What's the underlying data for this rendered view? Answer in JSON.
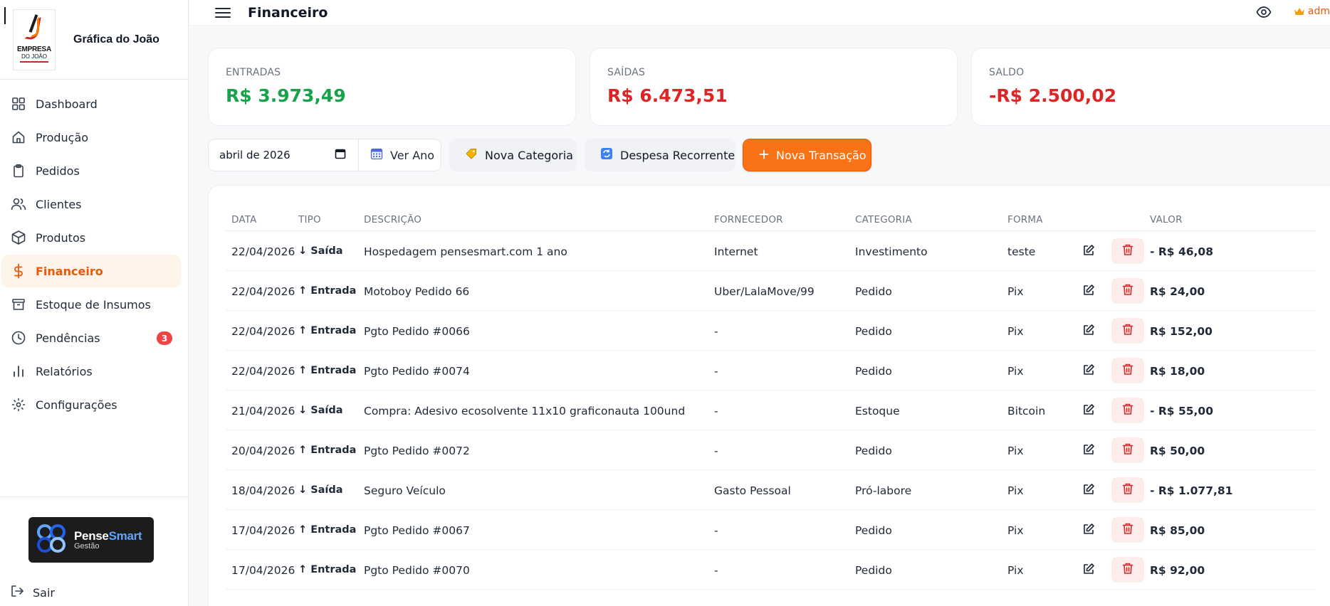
{
  "brand": {
    "logo_text_1": "EMPRESA",
    "logo_text_2": "DO JOÃO",
    "name": "Gráfica do João"
  },
  "sidebar": {
    "items": [
      {
        "label": "Dashboard",
        "icon": "grid-icon"
      },
      {
        "label": "Produção",
        "icon": "home-icon"
      },
      {
        "label": "Pedidos",
        "icon": "clipboard-icon"
      },
      {
        "label": "Clientes",
        "icon": "users-icon"
      },
      {
        "label": "Produtos",
        "icon": "box-icon"
      },
      {
        "label": "Financeiro",
        "icon": "dollar-icon",
        "active": true
      },
      {
        "label": "Estoque de Insumos",
        "icon": "archive-icon"
      },
      {
        "label": "Pendências",
        "icon": "clock-icon",
        "badge": "3"
      },
      {
        "label": "Relatórios",
        "icon": "bar-chart-icon"
      },
      {
        "label": "Configurações",
        "icon": "settings-icon"
      }
    ],
    "footer_logo_line1_a": "Pense",
    "footer_logo_line1_b": "Smart",
    "footer_logo_line2": "Gestão",
    "logout_label": "Sair"
  },
  "header": {
    "title": "Financeiro",
    "user_label": "adm"
  },
  "summary": {
    "entradas_label": "ENTRADAS",
    "entradas_value": "R$ 3.973,49",
    "saidas_label": "SAÍDAS",
    "saidas_value": "R$ 6.473,51",
    "saldo_label": "SALDO",
    "saldo_value": "-R$ 2.500,02"
  },
  "filters": {
    "month_value": "abril de 2026",
    "year_button": "Ver Ano",
    "new_category": "Nova Categoria",
    "recurring_expense": "Despesa Recorrente",
    "new_transaction": "Nova Transação"
  },
  "table": {
    "headers": [
      "DATA",
      "TIPO",
      "DESCRIÇÃO",
      "FORNECEDOR",
      "CATEGORIA",
      "FORMA",
      "VALOR"
    ],
    "rows": [
      {
        "date": "22/04/2026",
        "type": "↓ Saída",
        "kind": "out",
        "description": "Hospedagem pensesmart.com 1 ano",
        "supplier": "Internet",
        "category": "Investimento",
        "method": "teste",
        "value": "- R$ 46,08"
      },
      {
        "date": "22/04/2026",
        "type": "↑ Entrada",
        "kind": "in",
        "description": "Motoboy Pedido 66",
        "supplier": "Uber/LalaMove/99",
        "category": "Pedido",
        "method": "Pix",
        "value": "R$ 24,00"
      },
      {
        "date": "22/04/2026",
        "type": "↑ Entrada",
        "kind": "in",
        "description": "Pgto Pedido #0066",
        "supplier": "-",
        "category": "Pedido",
        "method": "Pix",
        "value": "R$ 152,00"
      },
      {
        "date": "22/04/2026",
        "type": "↑ Entrada",
        "kind": "in",
        "description": "Pgto Pedido #0074",
        "supplier": "-",
        "category": "Pedido",
        "method": "Pix",
        "value": "R$ 18,00"
      },
      {
        "date": "21/04/2026",
        "type": "↓ Saída",
        "kind": "out",
        "description": "Compra: Adesivo ecosolvente 11x10 graficonauta 100und",
        "supplier": "-",
        "category": "Estoque",
        "method": "Bitcoin",
        "value": "- R$ 55,00"
      },
      {
        "date": "20/04/2026",
        "type": "↑ Entrada",
        "kind": "in",
        "description": "Pgto Pedido #0072",
        "supplier": "-",
        "category": "Pedido",
        "method": "Pix",
        "value": "R$ 50,00"
      },
      {
        "date": "18/04/2026",
        "type": "↓ Saída",
        "kind": "out",
        "description": "Seguro Veículo",
        "supplier": "Gasto Pessoal",
        "category": "Pró-labore",
        "method": "Pix",
        "value": "- R$ 1.077,81"
      },
      {
        "date": "17/04/2026",
        "type": "↑ Entrada",
        "kind": "in",
        "description": "Pgto Pedido #0067",
        "supplier": "-",
        "category": "Pedido",
        "method": "Pix",
        "value": "R$ 85,00"
      },
      {
        "date": "17/04/2026",
        "type": "↑ Entrada",
        "kind": "in",
        "description": "Pgto Pedido #0070",
        "supplier": "-",
        "category": "Pedido",
        "method": "Pix",
        "value": "R$ 92,00"
      }
    ]
  },
  "colors": {
    "accent": "#f97316",
    "positive": "#16a34a",
    "negative": "#dc2626"
  }
}
